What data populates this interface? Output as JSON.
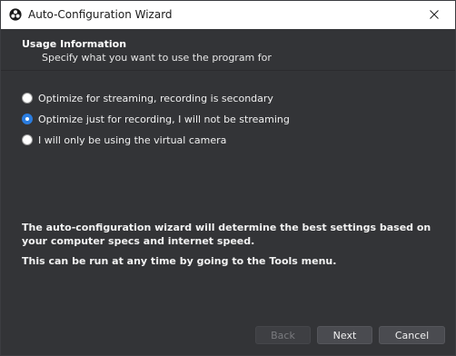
{
  "window": {
    "title": "Auto-Configuration Wizard",
    "close_symbol": "✕"
  },
  "header": {
    "title": "Usage Information",
    "subtitle": "Specify what you want to use the program for"
  },
  "options": [
    {
      "label": "Optimize for streaming, recording is secondary",
      "selected": false
    },
    {
      "label": "Optimize just for recording, I will not be streaming",
      "selected": true
    },
    {
      "label": "I will only be using the virtual camera",
      "selected": false
    }
  ],
  "info": {
    "line1": "The auto-configuration wizard will determine the best settings based on your computer specs and internet speed.",
    "line2": "This can be run at any time by going to the Tools menu."
  },
  "buttons": {
    "back": "Back",
    "next": "Next",
    "cancel": "Cancel"
  },
  "colors": {
    "background": "#333437",
    "titlebar": "#ffffff",
    "radio_selected": "#2b7de0"
  },
  "icons": {
    "app": "obs-logo-icon",
    "close": "close-icon"
  }
}
